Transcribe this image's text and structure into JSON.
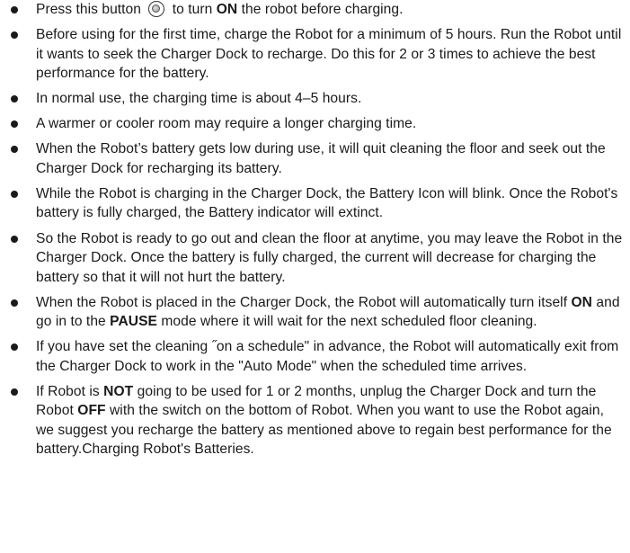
{
  "items": [
    {
      "pre": "Press this button",
      "icon": "power-button-icon",
      "mid": "to turn",
      "bold": "ON",
      "post": "the robot before charging."
    },
    {
      "text": "Before using for the first time, charge the Robot for a minimum of 5 hours. Run the Robot until it wants to seek the Charger Dock to recharge. Do this for 2 or 3 times to achieve the best performance for the battery."
    },
    {
      "text": "In normal use, the charging time is about 4–5 hours."
    },
    {
      "text": "A warmer or cooler room may require a longer charging time."
    },
    {
      "text": "When the Robot’s battery gets low during use, it will quit cleaning the floor and seek out the Charger Dock for recharging its battery."
    },
    {
      "text": "While the Robot is charging in the Charger Dock, the Battery Icon will blink. Once the Robot's battery is fully charged, the Battery indicator will extinct."
    },
    {
      "text": "So the Robot is ready to go out and clean the floor at anytime, you may leave the Robot in the Charger Dock. Once the battery is fully charged, the current will decrease for charging the battery so that it will not hurt the battery."
    },
    {
      "pre": "When the Robot is placed in the Charger Dock, the Robot will automatically turn itself",
      "bold1": "ON",
      "mid": "and go in to the",
      "bold2": "PAUSE",
      "post": "mode where it will wait for the next scheduled floor cleaning."
    },
    {
      "text": "If you have set the cleaning ˝on a schedule\" in advance, the Robot will automatically exit from the Charger Dock to work in the \"Auto Mode\" when the scheduled time arrives."
    },
    {
      "pre": "If Robot is",
      "bold1": "NOT",
      "mid": "going to be used for 1 or 2 months, unplug the Charger Dock and turn the Robot",
      "bold2": "OFF",
      "post": "with the switch on the bottom of Robot. When you want to use the Robot again, we suggest you recharge the battery as mentioned above to regain best performance for the battery.Charging Robot's Batteries."
    }
  ]
}
